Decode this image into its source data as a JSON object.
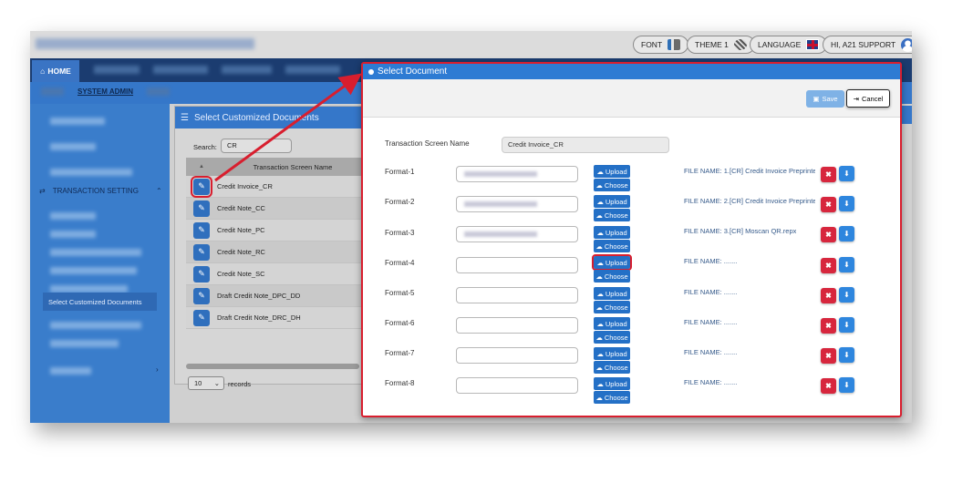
{
  "header": {
    "font_label": "FONT",
    "theme_label": "THEME 1",
    "language_label": "LANGUAGE",
    "user_label": "HI, A21 SUPPORT"
  },
  "nav": {
    "home_label": "HOME",
    "sub_active": "SYSTEM ADMIN"
  },
  "sidebar": {
    "section_title": "TRANSACTION SETTING",
    "active_item": "Select Customized Documents"
  },
  "panel": {
    "title": "Select Customized Documents",
    "search_label": "Search:",
    "search_value": "CR",
    "column_header": "Transaction Screen Name",
    "rows": [
      "Credit Invoice_CR",
      "Credit Note_CC",
      "Credit Note_PC",
      "Credit Note_RC",
      "Credit Note_SC",
      "Draft Credit Note_DPC_DD",
      "Draft Credit Note_DRC_DH"
    ],
    "page_size": "10",
    "records_label": "records"
  },
  "modal": {
    "title": "Select Document",
    "save_label": "Save",
    "cancel_label": "Cancel",
    "ts_label": "Transaction Screen Name",
    "ts_value": "Credit Invoice_CR",
    "upload_label": "Upload",
    "choose_label": "Choose",
    "formats": [
      {
        "label": "Format-1",
        "file": "FILE NAME: 1.[CR] Credit Invoice Preprinte"
      },
      {
        "label": "Format-2",
        "file": "FILE NAME: 2.[CR] Credit Invoice Preprinte"
      },
      {
        "label": "Format-3",
        "file": "FILE NAME: 3.[CR] Moscan QR.repx"
      },
      {
        "label": "Format-4",
        "file": "FILE NAME: ......."
      },
      {
        "label": "Format-5",
        "file": "FILE NAME: ......."
      },
      {
        "label": "Format-6",
        "file": "FILE NAME: ......."
      },
      {
        "label": "Format-7",
        "file": "FILE NAME: ......."
      },
      {
        "label": "Format-8",
        "file": "FILE NAME: ......."
      }
    ]
  },
  "colors": {
    "primary": "#2470c6",
    "highlight": "#d81e2e",
    "delete": "#d7263d",
    "download": "#2e86de"
  }
}
